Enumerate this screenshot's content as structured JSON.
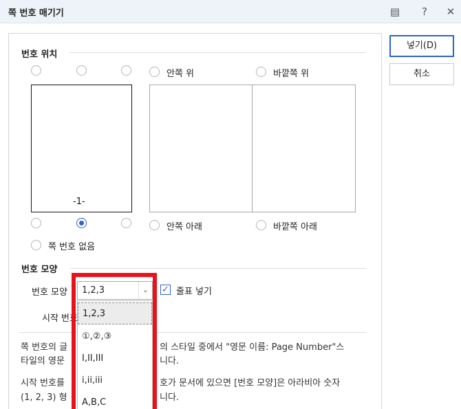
{
  "window": {
    "title": "쪽 번호 매기기",
    "icons": [
      "comment-icon",
      "help-icon",
      "close-icon"
    ],
    "help_glyph": "?",
    "close_glyph": "✕",
    "comment_glyph": "▤"
  },
  "buttons": {
    "insert": "넣기(D)",
    "cancel": "취소"
  },
  "position": {
    "section_label": "번호 위치",
    "top_radios": [
      "",
      "",
      ""
    ],
    "inner_top": "안쪽 위",
    "outer_top": "바깥쪽 위",
    "preview_number": "-1-",
    "inner_bottom": "안쪽 아래",
    "outer_bottom": "바깥쪽 아래",
    "no_number": "쪽 번호 없음",
    "selected": "bottom-center"
  },
  "format": {
    "section_label": "번호 모양",
    "shape_label": "번호 모양",
    "shape_value": "1,2,3",
    "start_label": "시작 번호",
    "add_dash_label": "줄표 넣기",
    "add_dash_checked": true,
    "checkbox_glyph": "✓",
    "arrow_glyph": "⌄"
  },
  "dropdown": {
    "options": [
      "1,2,3",
      "①,②,③",
      "I,II,III",
      "i,ii,iii",
      "A,B,C"
    ],
    "selected_index": 0
  },
  "description": {
    "line1_left": "쪽 번호의 글",
    "line1_right": "의 스타일 중에서 \"영문 이름: Page Number\"스",
    "line2_left": "타일의 영문",
    "line2_right": "니다.",
    "line3_left": "시작 번호를",
    "line3_right": "호가 문서에 있으면 [번호 모양]은 아라비아 숫자",
    "line4_left": "(1, 2, 3) 형",
    "line4_right": "니다."
  },
  "colors": {
    "accent": "#2a63c9",
    "highlight": "#e8121b",
    "titlebar": "#eef3fa"
  }
}
